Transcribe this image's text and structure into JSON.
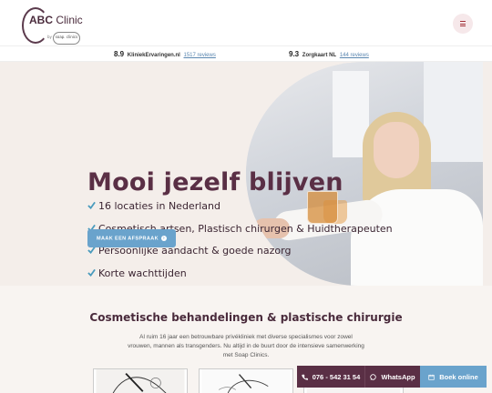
{
  "header": {
    "logo": {
      "brand": "ABC",
      "name": "Clinic",
      "by": "by",
      "partner": "soap. clinics"
    },
    "menu_icon": "hamburger-icon"
  },
  "ratings": [
    {
      "score": "8.9",
      "site": "KliniekErvaringen.nl",
      "reviews": "1517 reviews"
    },
    {
      "score": "9.3",
      "site": "Zorgkaart NL",
      "reviews": "144 reviews"
    }
  ],
  "hero": {
    "title": "Mooi jezelf blijven",
    "checks": [
      "16 locaties in Nederland",
      "Cosmetisch artsen, Plastisch chirurgen & Huidtherapeuten",
      "Persoonlijke aandacht & goede nazorg",
      "Korte wachttijden"
    ],
    "cta_label": "MAAK EEN AFSPRAAK",
    "check_color": "#4a9bbd"
  },
  "section": {
    "title": "Cosmetische behandelingen & plastische chirurgie",
    "text": "Al ruim 16 jaar een betrouwbare privékliniek met diverse specialismes voor zowel vrouwen, mannen als transgenders. Nu altijd in de buurt door de intensieve samenwerking met Soap Clinics."
  },
  "bottom_bar": {
    "phone": "076 - 542 31 54",
    "whatsapp": "WhatsApp",
    "book": "Boek online"
  },
  "colors": {
    "brand_plum": "#5a2f45",
    "accent_blue": "#6aa3cc",
    "hero_bg": "#f4eeea"
  }
}
